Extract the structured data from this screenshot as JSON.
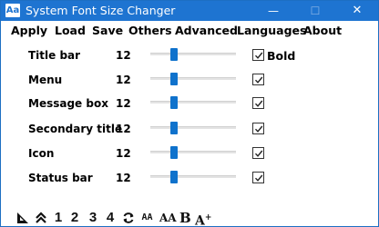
{
  "window": {
    "title": "System Font Size Changer",
    "icon_text": "Aa",
    "minimize_glyph": "—",
    "maximize_glyph": "☐",
    "close_glyph": "✕"
  },
  "menu": [
    "Apply",
    "Load",
    "Save",
    "Others",
    "Advanced",
    "Languages",
    "About"
  ],
  "rows": [
    {
      "label": "Title bar",
      "value": "12",
      "slider_fraction": 0.25,
      "checked": true
    },
    {
      "label": "Menu",
      "value": "12",
      "slider_fraction": 0.25,
      "checked": true
    },
    {
      "label": "Message box",
      "value": "12",
      "slider_fraction": 0.25,
      "checked": true
    },
    {
      "label": "Secondary title",
      "value": "12",
      "slider_fraction": 0.25,
      "checked": true
    },
    {
      "label": "Icon",
      "value": "12",
      "slider_fraction": 0.25,
      "checked": true
    },
    {
      "label": "Status bar",
      "value": "12",
      "slider_fraction": 0.25,
      "checked": true
    }
  ],
  "bold_label": "Bold",
  "toolbar": {
    "corner_icon": "corner-resize-icon",
    "up_icon": "double-chevron-up-icon",
    "numbers": [
      "1",
      "2",
      "3",
      "4"
    ],
    "refresh_icon": "refresh-icon",
    "font_small": "AA",
    "font_medium": "AA",
    "font_bold": "B",
    "font_bigger": "A",
    "font_bigger_plus": "+"
  },
  "colors": {
    "titlebar": "#1e74d1",
    "slider_thumb": "#0f72cc",
    "slider_track": "#e3e3e3"
  }
}
